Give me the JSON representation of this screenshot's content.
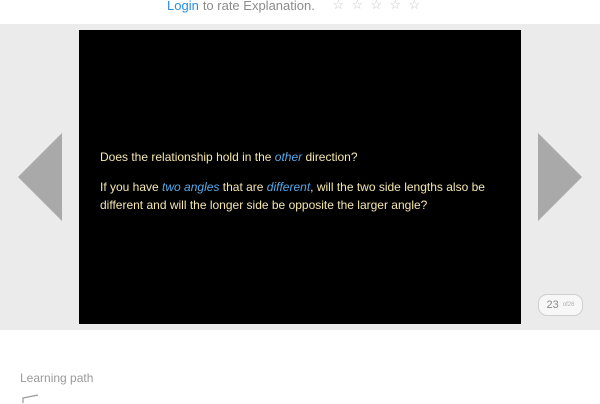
{
  "header": {
    "login_label": "Login",
    "rate_text": "to rate Explanation.",
    "stars": [
      "☆",
      "☆",
      "☆",
      "☆",
      "☆"
    ]
  },
  "slide": {
    "line1_before": "Does the relationship hold in the ",
    "line1_em": "other",
    "line1_after": " direction?",
    "line2_before": "If you have ",
    "line2_em1": "two angles",
    "line2_mid": " that are ",
    "line2_em2": "different",
    "line2_after": ", will the two side lengths also be different and will the longer side be opposite the larger angle?"
  },
  "pager": {
    "current": "23",
    "total": "of26"
  },
  "footer": {
    "learning_path_label": "Learning path"
  },
  "icons": {
    "prev": "arrow-left-icon",
    "next": "arrow-right-icon",
    "path": "learning-path-icon"
  },
  "colors": {
    "link": "#2b8fd6",
    "slide_text": "#f3e6b0",
    "slide_emphasis": "#5aa7e6",
    "slide_background": "#000000",
    "stage_background": "#ebebeb"
  }
}
